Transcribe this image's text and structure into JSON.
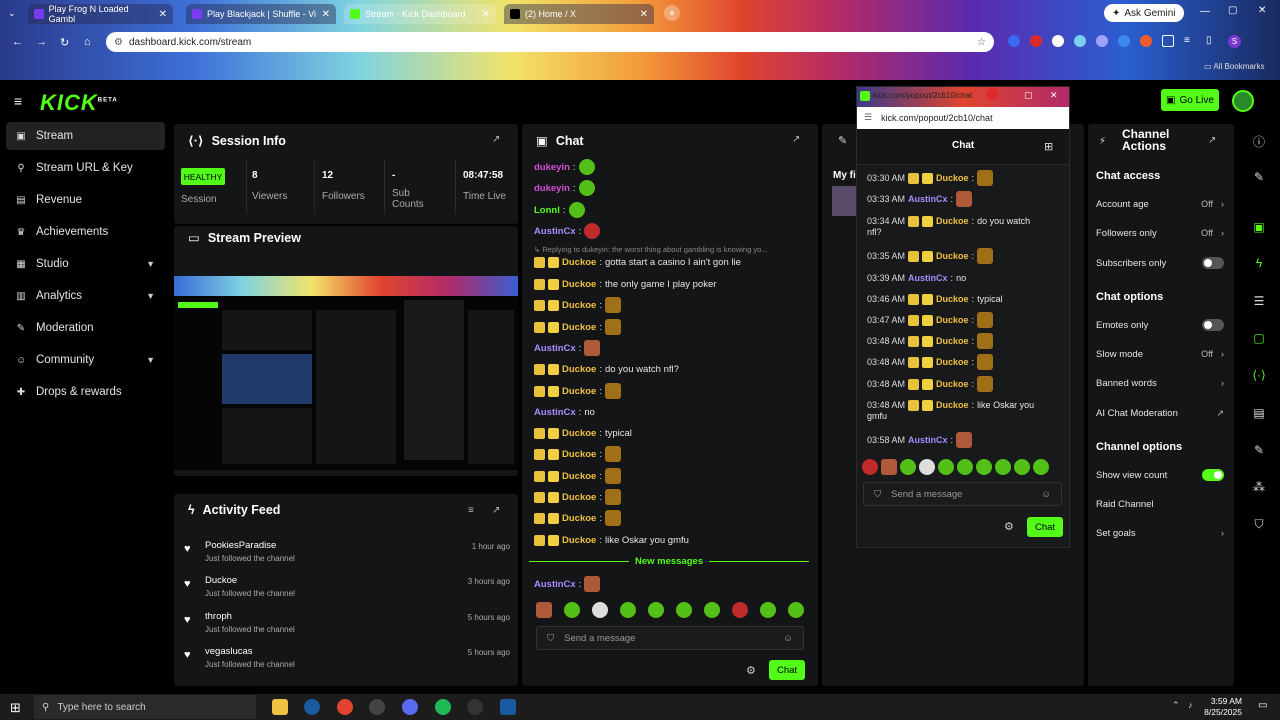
{
  "browser": {
    "tabs": [
      {
        "label": "Play Frog N Loaded Gambl",
        "color": "#7a3af0"
      },
      {
        "label": "Play Blackjack | Shuffle - Vi",
        "color": "#7a3af0"
      },
      {
        "label": "Stream - Kick Dashboard",
        "color": "#53fc18"
      },
      {
        "label": "(2) Home / X",
        "color": "#000000"
      }
    ],
    "url": "dashboard.kick.com/stream",
    "ask_gemini": "Ask Gemini",
    "bookmarks": "All Bookmarks"
  },
  "header": {
    "logo": "KICK",
    "beta": "BETA",
    "go_live": "Go Live"
  },
  "sidebar": {
    "items": [
      {
        "label": "Stream",
        "icon": "broadcast-icon",
        "active": true
      },
      {
        "label": "Stream URL & Key",
        "icon": "link-icon"
      },
      {
        "label": "Revenue",
        "icon": "chart-icon"
      },
      {
        "label": "Achievements",
        "icon": "trophy-icon"
      },
      {
        "label": "Studio",
        "icon": "studio-icon",
        "chevron": true
      },
      {
        "label": "Analytics",
        "icon": "analytics-icon",
        "chevron": true
      },
      {
        "label": "Moderation",
        "icon": "wrench-icon"
      },
      {
        "label": "Community",
        "icon": "community-icon",
        "chevron": true
      },
      {
        "label": "Drops & rewards",
        "icon": "gift-icon"
      }
    ]
  },
  "session": {
    "title": "Session Info",
    "health": "HEALTHY",
    "health_label": "Session",
    "stats": [
      {
        "value": "8",
        "label": "Viewers"
      },
      {
        "value": "12",
        "label": "Followers"
      },
      {
        "value": "-",
        "label": "Sub Counts"
      },
      {
        "value": "08:47:58",
        "label": "Time Live"
      }
    ]
  },
  "preview": {
    "title": "Stream Preview"
  },
  "activity": {
    "title": "Activity Feed",
    "items": [
      {
        "name": "PookiesParadise",
        "action": "Just followed the channel",
        "time": "1 hour ago"
      },
      {
        "name": "Duckoe",
        "action": "Just followed the channel",
        "time": "3 hours ago"
      },
      {
        "name": "throph",
        "action": "Just followed the channel",
        "time": "5 hours ago"
      },
      {
        "name": "vegaslucas",
        "action": "Just followed the channel",
        "time": "5 hours ago"
      }
    ]
  },
  "chat": {
    "title": "Chat",
    "messages": [
      {
        "name": "dukeyin",
        "color": "#d24fd8",
        "text": "",
        "emote": "green",
        "badges": 0
      },
      {
        "name": "dukeyin",
        "color": "#d24fd8",
        "text": "",
        "emote": "green",
        "badges": 0
      },
      {
        "name": "Lonnl",
        "color": "#53fc18",
        "text": "",
        "emote": "green",
        "badges": 0
      },
      {
        "name": "AustinCx",
        "color": "#a98bff",
        "text": "",
        "emote": "red",
        "badges": 0
      },
      {
        "name": "Duckoe",
        "color": "#f0c040",
        "text": "gotta start a casino I ain't gon lie",
        "emote": "",
        "badges": 2
      },
      {
        "name": "Duckoe",
        "color": "#f0c040",
        "text": "the only game I play poker",
        "emote": "",
        "badges": 2
      },
      {
        "name": "Duckoe",
        "color": "#f0c040",
        "text": "",
        "emote": "gold",
        "badges": 2
      },
      {
        "name": "Duckoe",
        "color": "#f0c040",
        "text": "",
        "emote": "gold",
        "badges": 2
      },
      {
        "name": "AustinCx",
        "color": "#a98bff",
        "text": "",
        "emote": "face",
        "badges": 0
      },
      {
        "name": "Duckoe",
        "color": "#f0c040",
        "text": "do you watch nfl?",
        "emote": "",
        "badges": 2
      },
      {
        "name": "Duckoe",
        "color": "#f0c040",
        "text": "",
        "emote": "gold",
        "badges": 2
      },
      {
        "name": "AustinCx",
        "color": "#a98bff",
        "text": "no",
        "emote": "",
        "badges": 0
      },
      {
        "name": "Duckoe",
        "color": "#f0c040",
        "text": "typical",
        "emote": "",
        "badges": 2
      },
      {
        "name": "Duckoe",
        "color": "#f0c040",
        "text": "",
        "emote": "gold",
        "badges": 2
      },
      {
        "name": "Duckoe",
        "color": "#f0c040",
        "text": "",
        "emote": "gold",
        "badges": 2
      },
      {
        "name": "Duckoe",
        "color": "#f0c040",
        "text": "",
        "emote": "gold",
        "badges": 2
      },
      {
        "name": "Duckoe",
        "color": "#f0c040",
        "text": "",
        "emote": "gold",
        "badges": 2
      },
      {
        "name": "Duckoe",
        "color": "#f0c040",
        "text": "like Oskar you gmfu",
        "emote": "",
        "badges": 2
      }
    ],
    "reply_note": "Replying to dukeyin: the worst thing about gambling is knowing yo...",
    "new_messages": "New messages",
    "last": {
      "name": "AustinCx",
      "color": "#a98bff"
    },
    "placeholder": "Send a message",
    "send": "Chat"
  },
  "middle": {
    "label": "My fi"
  },
  "popup": {
    "titlebar": "kick.com/popout/2cb10/chat",
    "url": "kick.com/popout/2cb10/chat",
    "title": "Chat",
    "messages": [
      {
        "time": "03:30 AM",
        "name": "Duckoe",
        "color": "#f0c040",
        "text": "",
        "emote": "gold",
        "badges": 2
      },
      {
        "time": "03:33 AM",
        "name": "AustinCx",
        "color": "#a98bff",
        "text": "",
        "emote": "face",
        "badges": 0
      },
      {
        "time": "03:34 AM",
        "name": "Duckoe",
        "color": "#f0c040",
        "text": "do you watch",
        "text2": "nfl?",
        "emote": "",
        "badges": 2
      },
      {
        "time": "03:35 AM",
        "name": "Duckoe",
        "color": "#f0c040",
        "text": "",
        "emote": "gold",
        "badges": 2
      },
      {
        "time": "03:39 AM",
        "name": "AustinCx",
        "color": "#a98bff",
        "text": "no",
        "emote": "",
        "badges": 0
      },
      {
        "time": "03:46 AM",
        "name": "Duckoe",
        "color": "#f0c040",
        "text": "typical",
        "emote": "",
        "badges": 2
      },
      {
        "time": "03:47 AM",
        "name": "Duckoe",
        "color": "#f0c040",
        "text": "",
        "emote": "gold",
        "badges": 2
      },
      {
        "time": "03:48 AM",
        "name": "Duckoe",
        "color": "#f0c040",
        "text": "",
        "emote": "gold",
        "badges": 2
      },
      {
        "time": "03:48 AM",
        "name": "Duckoe",
        "color": "#f0c040",
        "text": "",
        "emote": "gold",
        "badges": 2
      },
      {
        "time": "03:48 AM",
        "name": "Duckoe",
        "color": "#f0c040",
        "text": "",
        "emote": "gold",
        "badges": 2
      },
      {
        "time": "03:48 AM",
        "name": "Duckoe",
        "color": "#f0c040",
        "text": "like Oskar you",
        "text2": "gmfu",
        "emote": "",
        "badges": 2
      },
      {
        "time": "03:58 AM",
        "name": "AustinCx",
        "color": "#a98bff",
        "text": "",
        "emote": "face",
        "badges": 0
      }
    ],
    "placeholder": "Send a message",
    "send": "Chat"
  },
  "channel_actions": {
    "title": "Channel Actions",
    "chat_access": "Chat access",
    "account_age": {
      "label": "Account age",
      "value": "Off"
    },
    "followers_only": {
      "label": "Followers only",
      "value": "Off"
    },
    "subscribers_only": {
      "label": "Subscribers only"
    },
    "chat_options": "Chat options",
    "emotes_only": {
      "label": "Emotes only"
    },
    "slow_mode": {
      "label": "Slow mode",
      "value": "Off"
    },
    "banned_words": {
      "label": "Banned words"
    },
    "ai_mod": {
      "label": "AI Chat Moderation"
    },
    "channel_options": "Channel options",
    "show_view_count": {
      "label": "Show view count"
    },
    "raid_channel": {
      "label": "Raid Channel"
    },
    "set_goals": {
      "label": "Set goals"
    }
  },
  "taskbar": {
    "search_placeholder": "Type here to search",
    "time": "3:59 AM",
    "date": "8/25/2025"
  }
}
